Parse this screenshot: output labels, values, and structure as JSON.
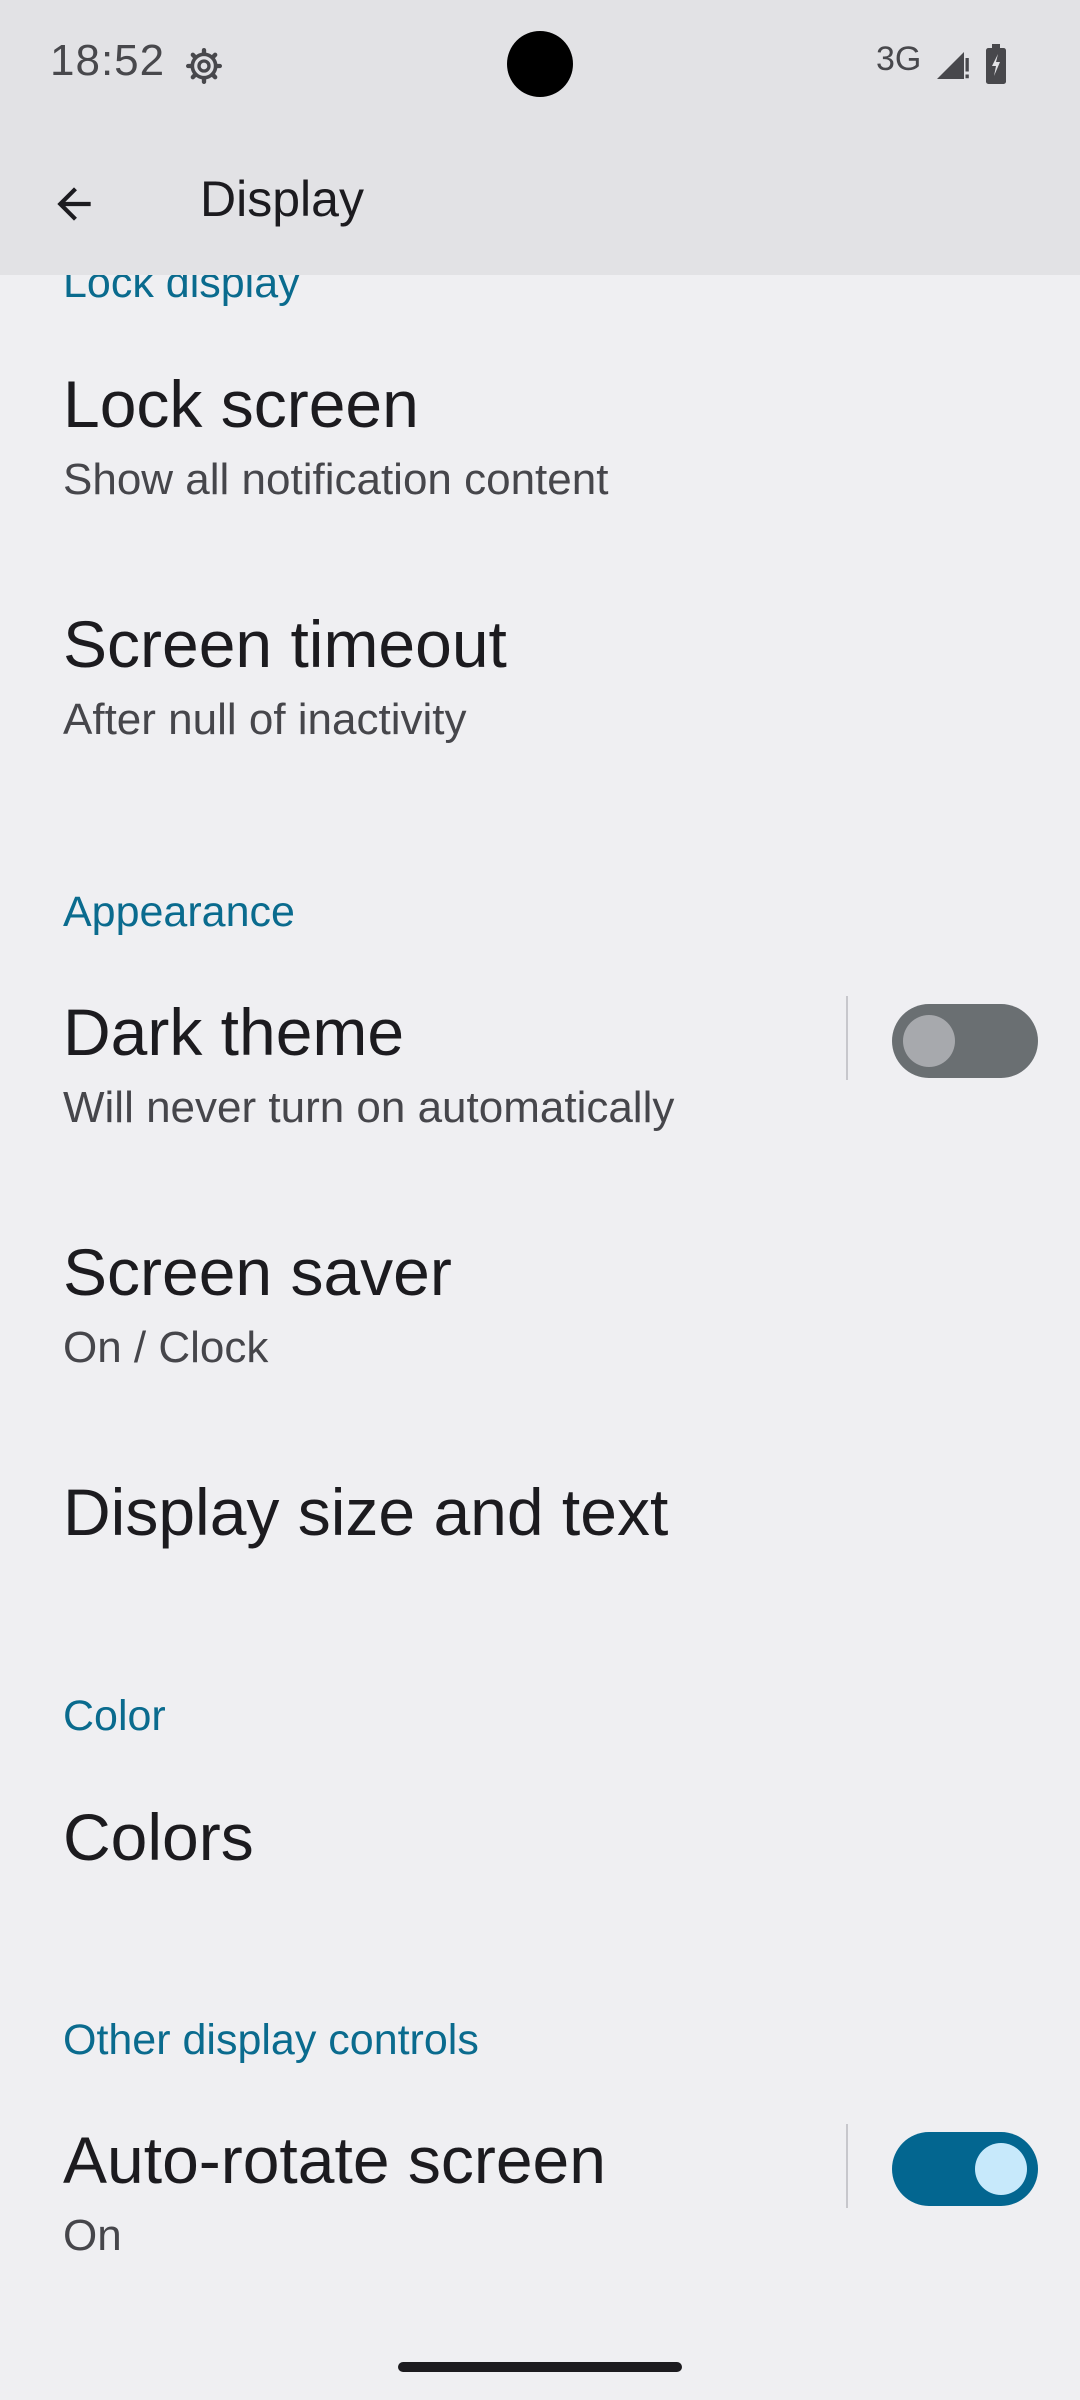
{
  "status_bar": {
    "time": "18:52",
    "network": "3G",
    "icons": [
      "settings-gear-icon",
      "signal-icon",
      "battery-charging-icon"
    ]
  },
  "app_bar": {
    "title": "Display",
    "back_icon": "arrow-back-icon"
  },
  "sections": {
    "lock_display": {
      "header": "Lock display",
      "lock_screen": {
        "title": "Lock screen",
        "summary": "Show all notification content"
      },
      "screen_timeout": {
        "title": "Screen timeout",
        "summary": "After null of inactivity"
      }
    },
    "appearance": {
      "header": "Appearance",
      "dark_theme": {
        "title": "Dark theme",
        "summary": "Will never turn on automatically",
        "enabled": false
      },
      "screen_saver": {
        "title": "Screen saver",
        "summary": "On / Clock"
      },
      "display_size": {
        "title": "Display size and text"
      }
    },
    "color": {
      "header": "Color",
      "colors": {
        "title": "Colors"
      }
    },
    "other": {
      "header": "Other display controls",
      "auto_rotate": {
        "title": "Auto-rotate screen",
        "summary": "On",
        "enabled": true
      }
    }
  },
  "colors": {
    "accent": "#0a6b8e",
    "switch_on": "#036690",
    "switch_off": "#6a6f72",
    "app_bar_bg": "#e2e2e5",
    "page_bg": "#efeff2"
  }
}
